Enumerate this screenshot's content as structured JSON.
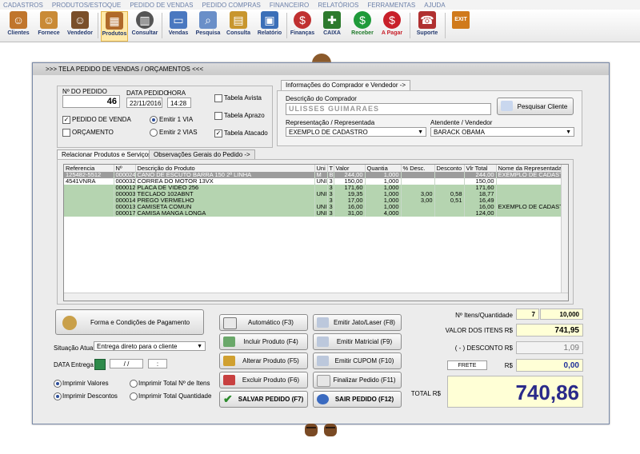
{
  "menu": [
    "CADASTROS",
    "PRODUTOS/ESTOQUE",
    "PEDIDO DE VENDAS",
    "PEDIDO COMPRAS",
    "FINANCEIRO",
    "RELATÓRIOS",
    "FERRAMENTAS",
    "AJUDA"
  ],
  "toolbar": {
    "clientes": "Clientes",
    "fornece": "Fornece",
    "vendedor": "Vendedor",
    "produtos": "Produtos",
    "consultar": "Consultar",
    "vendas": "Vendas",
    "pesquisa": "Pesquisa",
    "consulta": "Consulta",
    "relatorio": "Relatório",
    "financas": "Finanças",
    "caixa": "CAIXA",
    "receber": "Receber",
    "apagar": "A Pagar",
    "suporte": "Suporte",
    "exit": "EXIT"
  },
  "window": {
    "title": ">>>  TELA PEDIDO DE VENDAS / ORÇAMENTOS  <<<"
  },
  "order": {
    "numero_label": "Nº DO PEDIDO",
    "numero": "46",
    "data_label": "DATA PEDIDO",
    "data": "22/11/2016",
    "hora_label": "HORA",
    "hora": "14:28",
    "pedido_venda": "PEDIDO DE VENDA",
    "orcamento": "ORÇAMENTO",
    "emitir1": "Emitir 1 VIA",
    "emitir2": "Emitir 2 VIAS",
    "tab_avista": "Tabela Avista",
    "tab_aprazo": "Tabela Aprazo",
    "tab_atacado": "Tabela Atacado"
  },
  "buyer": {
    "tab": "Informações do Comprador e Vendedor ->",
    "desc_label": "Descrição do Comprador",
    "desc_value": "ULISSES GUIMARAES",
    "pesquisar": "Pesquisar Cliente",
    "rep_label": "Representação / Representada",
    "rep_value": "EXEMPLO DE CADASTRO",
    "atend_label": "Atendente / Vendedor",
    "atend_value": "BARACK OBAMA"
  },
  "tabs": {
    "produtos": "Relacionar Produtos e Serviços ->",
    "obs": "Observações Gerais do Pedido ->"
  },
  "grid": {
    "columns": [
      "Referencia",
      "Nº",
      "Descrição do Produto",
      "Uni",
      "T",
      "Valor",
      "Quantia",
      "% Desc.",
      "Desconto",
      "Vlr Total",
      "Nome da Representada"
    ],
    "rows": [
      {
        "ref": "125482-5512",
        "n": "000024",
        "desc": "CANO DE ESCUTO BARRA 150 2ª LINHA",
        "uni": "M",
        "t": "B",
        "valor": "244,00",
        "qtd": "1,000",
        "pdesc": "",
        "desconto": "",
        "total": "244,00",
        "rep": "EXEMPLO DE CADASTRO",
        "style": "sel"
      },
      {
        "ref": "4541VNRA",
        "n": "000032",
        "desc": "CORREA DO MOTOR 13VX",
        "uni": "UNI",
        "t": "3",
        "valor": "150,00",
        "qtd": "1,000",
        "pdesc": "",
        "desconto": "",
        "total": "150,00",
        "rep": "",
        "style": "white"
      },
      {
        "ref": "",
        "n": "000012",
        "desc": "PLACA DE VIDEO 256",
        "uni": "",
        "t": "3",
        "valor": "171,60",
        "qtd": "1,000",
        "pdesc": "",
        "desconto": "",
        "total": "171,60",
        "rep": "",
        "style": "green"
      },
      {
        "ref": "",
        "n": "000003",
        "desc": "TECLADO 102ABNT",
        "uni": "UNI",
        "t": "3",
        "valor": "19,35",
        "qtd": "1,000",
        "pdesc": "3,00",
        "desconto": "0,58",
        "total": "18,77",
        "rep": "",
        "style": "green"
      },
      {
        "ref": "",
        "n": "000014",
        "desc": "PREGO VERMELHO",
        "uni": "",
        "t": "3",
        "valor": "17,00",
        "qtd": "1,000",
        "pdesc": "3,00",
        "desconto": "0,51",
        "total": "16,49",
        "rep": "",
        "style": "green"
      },
      {
        "ref": "",
        "n": "000013",
        "desc": "CAMISETA COMUN",
        "uni": "UNI",
        "t": "3",
        "valor": "16,00",
        "qtd": "1,000",
        "pdesc": "",
        "desconto": "",
        "total": "16,00",
        "rep": "EXEMPLO DE CADASTRO",
        "style": "green"
      },
      {
        "ref": "",
        "n": "000017",
        "desc": "CAMISA MANGA LONGA",
        "uni": "UNI",
        "t": "3",
        "valor": "31,00",
        "qtd": "4,000",
        "pdesc": "",
        "desconto": "",
        "total": "124,00",
        "rep": "",
        "style": "green"
      }
    ]
  },
  "bottom": {
    "forma": "Forma e Condições de Pagamento",
    "situacao_label": "Situação Atual",
    "situacao_value": "Entrega direto para o cliente",
    "entrega_label": "DATA Entrega",
    "entrega_date": "/  /",
    "entrega_time": ":",
    "imprimir_valores": "Imprimir Valores",
    "imprimir_descontos": "Imprimir Descontos",
    "imprimir_total_itens": "Imprimir Total Nº de Itens",
    "imprimir_total_qtd": "Imprimir Total Quantidade"
  },
  "actions": {
    "automatico": "Automático         (F3)",
    "incluir": "Incluir Produto   (F4)",
    "alterar": "Alterar Produto   (F5)",
    "excluir": "Excluir Produto   (F6)",
    "salvar": "SALVAR PEDIDO (F7)",
    "jato": "Emitir Jato/Laser (F8)",
    "matricial": "Emitir Matricial   (F9)",
    "cupom": "Emitir CUPOM    (F10)",
    "finalizar": "Finalizar Pedido  (F11)",
    "sair": "SAIR  PEDIDO  (F12)"
  },
  "totals": {
    "itens_label": "Nº Itens/Quantidade",
    "itens": "7",
    "quantidade": "10,000",
    "valor_label": "VALOR DOS ITENS R$",
    "valor": "741,95",
    "desconto_label": "( - ) DESCONTO R$",
    "desconto": "1,09",
    "frete_label": "FRETE",
    "frete_rs": "R$",
    "frete": "0,00",
    "total_label": "TOTAL R$",
    "total": "740,86"
  }
}
